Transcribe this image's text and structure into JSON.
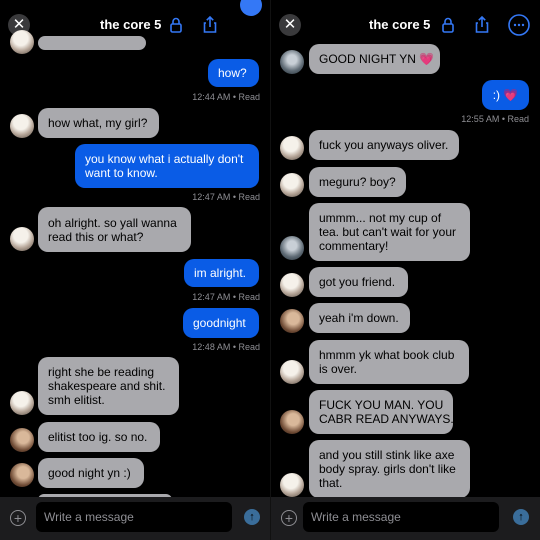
{
  "left": {
    "title": "the core 5",
    "composer_placeholder": "Write a message",
    "messages": [
      {
        "text": "how?",
        "side": "out"
      },
      {
        "text": "12:44 AM • Read"
      },
      {
        "text": "how what, my girl?",
        "side": "in"
      },
      {
        "lines": [
          "you know what i actually don't",
          "want to know."
        ],
        "side": "out"
      },
      {
        "text": "12:47 AM • Read"
      },
      {
        "lines": [
          "oh alright. so yall wanna",
          "read this or what?"
        ],
        "side": "in"
      },
      {
        "text": "im alright.",
        "side": "out"
      },
      {
        "text": "12:47 AM • Read"
      },
      {
        "text": "goodnight",
        "side": "out"
      },
      {
        "text": "12:48 AM • Read"
      },
      {
        "lines": [
          "right she be reading",
          "shakespeare and shit.",
          "smh elitist."
        ],
        "side": "in"
      },
      {
        "text": "elitist too ig. so no.",
        "side": "in"
      },
      {
        "text": "good night yn :)",
        "side": "in"
      }
    ]
  },
  "right": {
    "title": "the core 5",
    "composer_placeholder": "Write a message",
    "messages": [
      {
        "text": "GOOD NIGHT YN 💗",
        "side": "in"
      },
      {
        "text": ":) 💗",
        "side": "out"
      },
      {
        "text": "12:55 AM • Read"
      },
      {
        "text": "fuck you anyways oliver.",
        "side": "in"
      },
      {
        "text": "meguru? boy?",
        "side": "in"
      },
      {
        "lines": [
          "ummm... not my cup of",
          "tea. but can't wait for your",
          "commentary!"
        ],
        "side": "in"
      },
      {
        "text": "got you friend.",
        "side": "in"
      },
      {
        "text": "yeah i'm down.",
        "side": "in"
      },
      {
        "lines": [
          "hmmm yk what book club",
          "is over."
        ],
        "side": "in"
      },
      {
        "lines": [
          "FUCK YOU MAN. YOU",
          "CABR READ ANYWAYS."
        ],
        "side": "in"
      },
      {
        "lines": [
          "and you still stink like axe",
          "body spray. girls don't like",
          "that."
        ],
        "side": "in"
      }
    ]
  },
  "colors": {
    "incoming": "#a9a9ad",
    "outgoing": "#0a5ce6",
    "accent": "#3478f6"
  },
  "icons": [
    "close-icon",
    "lock-icon",
    "share-icon",
    "more-icon",
    "add-icon",
    "send-arrow-icon"
  ]
}
